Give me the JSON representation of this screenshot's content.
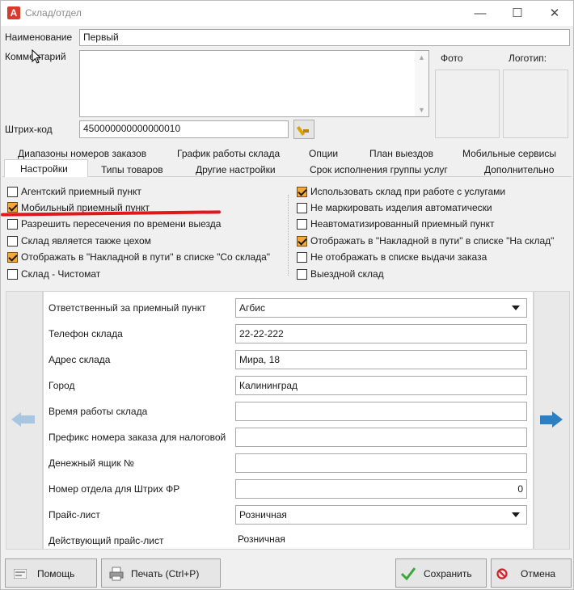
{
  "window": {
    "title": "Склад/отдел",
    "minimize": "—",
    "maximize": "☐",
    "close": "✕",
    "app_icon": "A"
  },
  "form": {
    "name_label": "Наименование",
    "name_value": "Первый",
    "comment_label": "Комментарий",
    "comment_value": "",
    "photo_label": "Фото",
    "logo_label": "Логотип:",
    "barcode_label": "Штрих-код",
    "barcode_value": "450000000000000010"
  },
  "tabs_row1": [
    "Диапазоны номеров заказов",
    "График работы склада",
    "Опции",
    "План выездов",
    "Мобильные сервисы"
  ],
  "tabs_row2": [
    "Настройки",
    "Типы товаров",
    "Другие настройки",
    "Срок исполнения группы услуг",
    "Дополнительно"
  ],
  "options_left": [
    {
      "label": "Агентский приемный пункт",
      "checked": false
    },
    {
      "label": "Мобильный приемный пункт",
      "checked": true
    },
    {
      "label": "Разрешить пересечения по времени выезда",
      "checked": false
    },
    {
      "label": "Склад является также цехом",
      "checked": false
    },
    {
      "label": "Отображать в \"Накладной в пути\" в списке \"Со склада\"",
      "checked": true
    },
    {
      "label": "Склад - Чистомат",
      "checked": false
    }
  ],
  "options_right": [
    {
      "label": "Использовать склад при работе с услугами",
      "checked": true
    },
    {
      "label": "Не маркировать изделия автоматически",
      "checked": false
    },
    {
      "label": "Неавтоматизированный приемный пункт",
      "checked": false
    },
    {
      "label": "Отображать в \"Накладной в пути\" в списке \"На склад\"",
      "checked": true
    },
    {
      "label": "Не отображать в списке выдачи заказа",
      "checked": false
    },
    {
      "label": "Выездной склад",
      "checked": false
    }
  ],
  "details": {
    "responsible_label": "Ответственный за приемный пункт",
    "responsible_value": "Агбис",
    "phone_label": "Телефон склада",
    "phone_value": "22-22-222",
    "address_label": "Адрес склада",
    "address_value": "Мира, 18",
    "city_label": "Город",
    "city_value": "Калининград",
    "hours_label": "Время работы склада",
    "hours_value": "",
    "prefix_label": "Префикс номера заказа для налоговой",
    "prefix_value": "",
    "cashbox_label": "Денежный ящик №",
    "cashbox_value": "",
    "dept_label": "Номер отдела для Штрих ФР",
    "dept_value": "0",
    "pricelist_label": "Прайс-лист",
    "pricelist_value": "Розничная",
    "active_pricelist_label": "Действующий прайс-лист",
    "active_pricelist_value": "Розничная"
  },
  "buttons": {
    "help": "Помощь",
    "print": "Печать (Ctrl+P)",
    "save": "Сохранить",
    "cancel": "Отмена"
  }
}
